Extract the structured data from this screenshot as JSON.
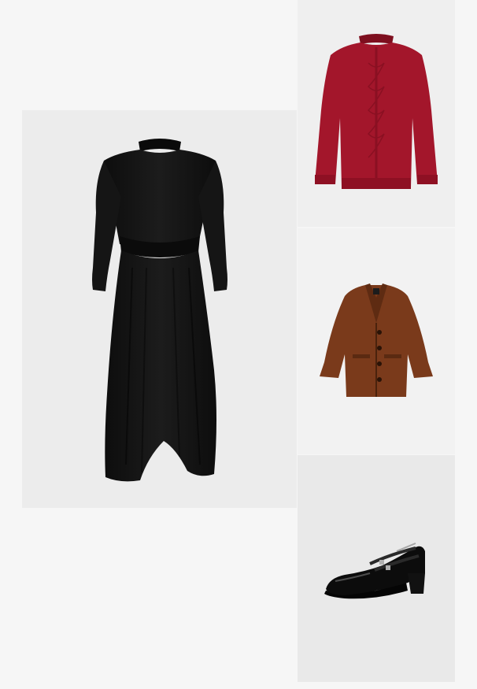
{
  "outfit": {
    "items": [
      {
        "name": "dress",
        "icon": "black-maxi-dress-image",
        "color": "#141414"
      },
      {
        "name": "sweater",
        "icon": "red-cable-knit-sweater-image",
        "color": "#a3162b"
      },
      {
        "name": "coat",
        "icon": "brown-wool-coat-image",
        "color": "#7a3a1b"
      },
      {
        "name": "shoes",
        "icon": "black-patent-mary-jane-shoe-image",
        "color": "#0c0c0c"
      }
    ],
    "background": "#f6f6f6"
  }
}
